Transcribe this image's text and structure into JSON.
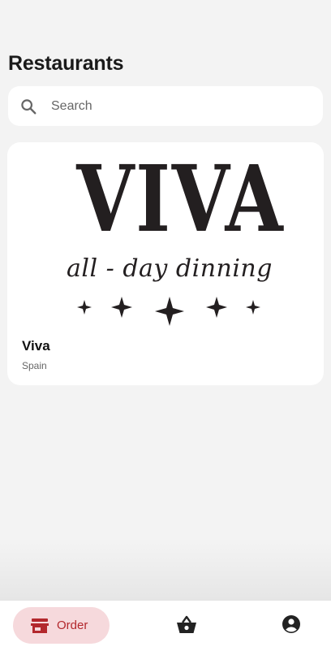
{
  "header": {
    "title": "Restaurants"
  },
  "search": {
    "placeholder": "Search",
    "value": "",
    "icon": "search-icon"
  },
  "restaurants": [
    {
      "name": "Viva",
      "country": "Spain",
      "logo": {
        "wordmark": "VIVA",
        "tagline": "all - day dinning",
        "color": "#231f20"
      }
    }
  ],
  "bottom_nav": {
    "items": [
      {
        "label": "Order",
        "icon": "store-icon",
        "active": true
      },
      {
        "label": "",
        "icon": "basket-icon",
        "active": false
      },
      {
        "label": "",
        "icon": "account-circle-icon",
        "active": false
      }
    ]
  },
  "colors": {
    "accent": "#b3282d",
    "accent_bg": "#f6d9dc",
    "background": "#f3f3f3",
    "card": "#ffffff"
  }
}
